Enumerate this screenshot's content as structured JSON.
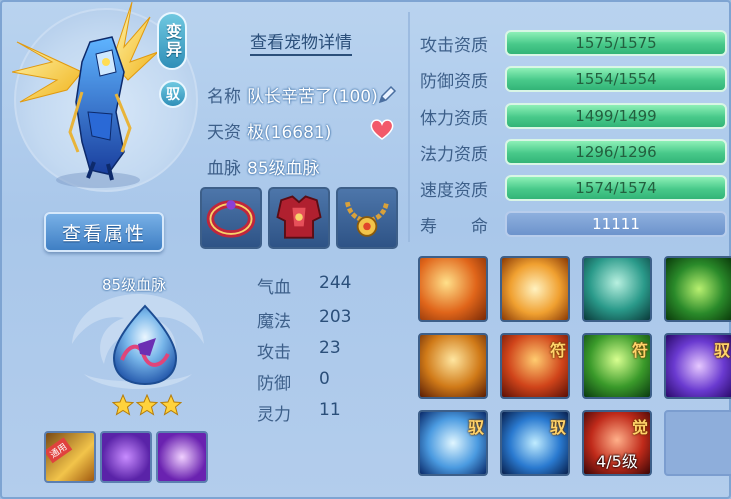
{
  "left": {
    "badge_mutant": "变异",
    "badge_tame": "驭",
    "view_attr_button": "查看属性",
    "blood_title": "85级血脉",
    "stars": 3,
    "small_skills": [
      {
        "tag": "通用",
        "icon": "golden-weapon-icon"
      },
      {
        "tag": "",
        "icon": "purple-dragon-icon"
      },
      {
        "tag": "",
        "icon": "purple-spirit-icon"
      }
    ]
  },
  "middle": {
    "title": "查看宠物详情",
    "name_label": "名称",
    "name_value": "队长辛苦了(100)",
    "aptitude_label": "天资",
    "aptitude_value": "极(16681)",
    "blood_label": "血脉",
    "blood_value": "85级血脉",
    "equipment": [
      "red-ring-icon",
      "red-armor-icon",
      "gold-necklace-icon"
    ],
    "stats": [
      {
        "label": "气血",
        "value": "244"
      },
      {
        "label": "魔法",
        "value": "203"
      },
      {
        "label": "攻击",
        "value": "23"
      },
      {
        "label": "防御",
        "value": "0"
      },
      {
        "label": "灵力",
        "value": "11"
      }
    ]
  },
  "right": {
    "attributes": [
      {
        "label": "攻击资质",
        "value": "1575/1575"
      },
      {
        "label": "防御资质",
        "value": "1554/1554"
      },
      {
        "label": "体力资质",
        "value": "1499/1499"
      },
      {
        "label": "法力资质",
        "value": "1296/1296"
      },
      {
        "label": "速度资质",
        "value": "1574/1574"
      },
      {
        "label": "寿　　命",
        "value": "11111"
      }
    ],
    "skills": [
      {
        "icon": "flaming-sword-icon",
        "mark": "",
        "level": ""
      },
      {
        "icon": "sword-strike-icon",
        "mark": "",
        "level": ""
      },
      {
        "icon": "shadow-clone-icon",
        "mark": "",
        "level": ""
      },
      {
        "icon": "green-demon-icon",
        "mark": "",
        "level": ""
      },
      {
        "icon": "golden-fist-icon",
        "mark": "",
        "level": ""
      },
      {
        "icon": "red-warrior-icon",
        "mark": "符",
        "level": ""
      },
      {
        "icon": "green-warrior-icon",
        "mark": "符",
        "level": ""
      },
      {
        "icon": "purple-punch-icon",
        "mark": "驭",
        "level": ""
      },
      {
        "icon": "ice-crystal-icon",
        "mark": "驭",
        "level": ""
      },
      {
        "icon": "swift-runner-icon",
        "mark": "驭",
        "level": ""
      },
      {
        "icon": "awaken-flame-icon",
        "mark": "觉",
        "level": "4/5级"
      },
      {
        "icon": "empty-slot",
        "mark": "",
        "level": ""
      }
    ]
  },
  "colors": {
    "bar_green": "#48c98a",
    "label_blue": "#3d5f89",
    "panel_bg": "#b3cdec"
  }
}
